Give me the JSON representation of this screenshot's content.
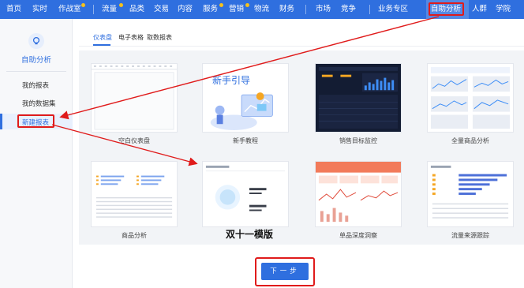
{
  "top_nav": {
    "items": [
      {
        "label": "首页"
      },
      {
        "label": "实时"
      },
      {
        "label": "作战室"
      },
      {
        "label": "流量"
      },
      {
        "label": "品类"
      },
      {
        "label": "交易"
      },
      {
        "label": "内容"
      },
      {
        "label": "服务"
      },
      {
        "label": "营销"
      },
      {
        "label": "物流"
      },
      {
        "label": "财务"
      },
      {
        "label": "市场"
      },
      {
        "label": "竞争"
      },
      {
        "label": "业务专区"
      },
      {
        "label": "自助分析"
      },
      {
        "label": "人群"
      },
      {
        "label": "学院"
      }
    ],
    "active": "自助分析"
  },
  "sidebar": {
    "icon": "lightbulb-icon",
    "title": "自助分析",
    "items": [
      {
        "label": "我的报表"
      },
      {
        "label": "我的数据集"
      },
      {
        "label": "新建报表"
      }
    ],
    "active_item": "新建报表"
  },
  "tabs": [
    {
      "label": "仪表盘"
    },
    {
      "label": "电子表格"
    },
    {
      "label": "取数报表"
    }
  ],
  "active_tab": "仪表盘",
  "templates": [
    {
      "label": "空白仪表盘",
      "thumb": "blank"
    },
    {
      "label": "新手教程",
      "thumb": "guide",
      "thumb_text": "新手引导"
    },
    {
      "label": "销售目标监控",
      "thumb": "dark"
    },
    {
      "label": "全量商品分析",
      "thumb": "lines"
    },
    {
      "label": "商品分析",
      "thumb": "table"
    },
    {
      "label": "双十一模版",
      "thumb": "circle"
    },
    {
      "label": "单品深度洞察",
      "thumb": "red"
    },
    {
      "label": "流量来源跟踪",
      "thumb": "bars"
    }
  ],
  "next_button": "下一步",
  "colors": {
    "primary": "#2f6fdf",
    "highlight": "#e01b1b",
    "accent_dot": "#f5c11b"
  }
}
